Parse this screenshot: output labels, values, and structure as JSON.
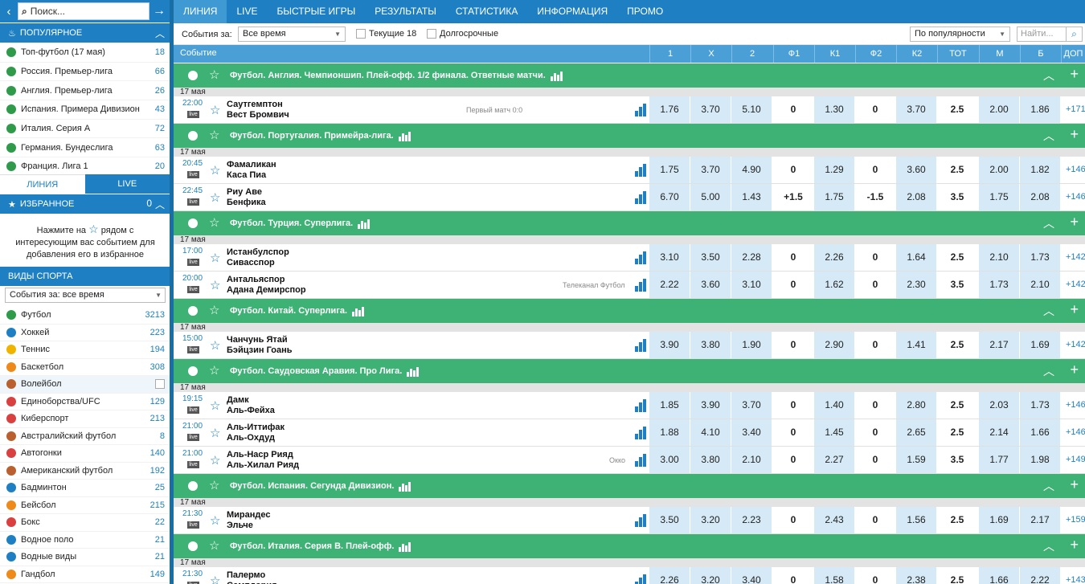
{
  "sidebar": {
    "search_placeholder": "Поиск...",
    "popular_title": "ПОПУЛЯРНОЕ",
    "popular": [
      {
        "label": "Топ-футбол (17 мая)",
        "count": "18"
      },
      {
        "label": "Россия. Премьер-лига",
        "count": "66"
      },
      {
        "label": "Англия. Премьер-лига",
        "count": "26"
      },
      {
        "label": "Испания. Примера Дивизион",
        "count": "43"
      },
      {
        "label": "Италия. Серия А",
        "count": "72"
      },
      {
        "label": "Германия. Бундеслига",
        "count": "63"
      },
      {
        "label": "Франция. Лига 1",
        "count": "20"
      }
    ],
    "tabs": {
      "line": "ЛИНИЯ",
      "live": "LIVE"
    },
    "favorites_title": "ИЗБРАННОЕ",
    "favorites_count": "0",
    "favorites_msg_1": "Нажмите на",
    "favorites_msg_2": "рядом с интересующим вас событием для добавления его в избранное",
    "sports_title": "ВИДЫ СПОРТА",
    "sports_filter": "События за: все время",
    "sports": [
      {
        "label": "Футбол",
        "count": "3213"
      },
      {
        "label": "Хоккей",
        "count": "223"
      },
      {
        "label": "Теннис",
        "count": "194"
      },
      {
        "label": "Баскетбол",
        "count": "308"
      },
      {
        "label": "Волейбол",
        "count": ""
      },
      {
        "label": "Единоборства/UFC",
        "count": "129"
      },
      {
        "label": "Киберспорт",
        "count": "213"
      },
      {
        "label": "Австралийский футбол",
        "count": "8"
      },
      {
        "label": "Автогонки",
        "count": "140"
      },
      {
        "label": "Американский футбол",
        "count": "192"
      },
      {
        "label": "Бадминтон",
        "count": "25"
      },
      {
        "label": "Бейсбол",
        "count": "215"
      },
      {
        "label": "Бокс",
        "count": "22"
      },
      {
        "label": "Водное поло",
        "count": "21"
      },
      {
        "label": "Водные виды",
        "count": "21"
      },
      {
        "label": "Гандбол",
        "count": "149"
      }
    ]
  },
  "nav": [
    "ЛИНИЯ",
    "LIVE",
    "БЫСТРЫЕ ИГРЫ",
    "РЕЗУЛЬТАТЫ",
    "СТАТИСТИКА",
    "ИНФОРМАЦИЯ",
    "ПРОМО"
  ],
  "filters": {
    "period_label": "События за:",
    "period_value": "Все время",
    "current_label": "Текущие 18",
    "longterm_label": "Долгосрочные",
    "sort_value": "По популярности",
    "search_placeholder": "Найти..."
  },
  "table": {
    "event_label": "Событие",
    "columns": [
      "1",
      "X",
      "2",
      "Ф1",
      "К1",
      "Ф2",
      "К2",
      "ТОТ",
      "М",
      "Б",
      "ДОП"
    ]
  },
  "groups": [
    {
      "league": "Футбол. Англия. Чемпионшип. Плей-офф. 1/2 финала. Ответные матчи.",
      "date": "17 мая",
      "events": [
        {
          "time": "22:00",
          "team1": "Саутгемптон",
          "team2": "Вест Бромвич",
          "note": "Первый матч 0:0",
          "odds": [
            "1.76",
            "3.70",
            "5.10",
            "0",
            "1.30",
            "0",
            "3.70",
            "2.5",
            "2.00",
            "1.86",
            "+171"
          ]
        }
      ]
    },
    {
      "league": "Футбол. Португалия. Примейра-лига.",
      "date": "17 мая",
      "events": [
        {
          "time": "20:45",
          "team1": "Фамаликан",
          "team2": "Каса Пиа",
          "note": "",
          "odds": [
            "1.75",
            "3.70",
            "4.90",
            "0",
            "1.29",
            "0",
            "3.60",
            "2.5",
            "2.00",
            "1.82",
            "+146"
          ]
        },
        {
          "time": "22:45",
          "team1": "Риу Аве",
          "team2": "Бенфика",
          "note": "",
          "odds": [
            "6.70",
            "5.00",
            "1.43",
            "+1.5",
            "1.75",
            "-1.5",
            "2.08",
            "3.5",
            "1.75",
            "2.08",
            "+146"
          ]
        }
      ]
    },
    {
      "league": "Футбол. Турция. Суперлига.",
      "date": "17 мая",
      "events": [
        {
          "time": "17:00",
          "team1": "Истанбулспор",
          "team2": "Сивасспор",
          "note": "",
          "odds": [
            "3.10",
            "3.50",
            "2.28",
            "0",
            "2.26",
            "0",
            "1.64",
            "2.5",
            "2.10",
            "1.73",
            "+142"
          ]
        },
        {
          "time": "20:00",
          "team1": "Антальяспор",
          "team2": "Адана Демирспор",
          "note": "Телеканал Футбол",
          "odds": [
            "2.22",
            "3.60",
            "3.10",
            "0",
            "1.62",
            "0",
            "2.30",
            "3.5",
            "1.73",
            "2.10",
            "+142"
          ]
        }
      ]
    },
    {
      "league": "Футбол. Китай. Суперлига.",
      "date": "17 мая",
      "events": [
        {
          "time": "15:00",
          "team1": "Чанчунь Ятай",
          "team2": "Бэйцзин Гоань",
          "note": "",
          "odds": [
            "3.90",
            "3.80",
            "1.90",
            "0",
            "2.90",
            "0",
            "1.41",
            "2.5",
            "2.17",
            "1.69",
            "+142"
          ]
        }
      ]
    },
    {
      "league": "Футбол. Саудовская Аравия. Про Лига.",
      "date": "17 мая",
      "events": [
        {
          "time": "19:15",
          "team1": "Дамк",
          "team2": "Аль-Фейха",
          "note": "",
          "odds": [
            "1.85",
            "3.90",
            "3.70",
            "0",
            "1.40",
            "0",
            "2.80",
            "2.5",
            "2.03",
            "1.73",
            "+146"
          ]
        },
        {
          "time": "21:00",
          "team1": "Аль-Иттифак",
          "team2": "Аль-Охдуд",
          "note": "",
          "odds": [
            "1.88",
            "4.10",
            "3.40",
            "0",
            "1.45",
            "0",
            "2.65",
            "2.5",
            "2.14",
            "1.66",
            "+146"
          ]
        },
        {
          "time": "21:00",
          "team1": "Аль-Наср Рияд",
          "team2": "Аль-Хилал Рияд",
          "note": "Окко",
          "odds": [
            "3.00",
            "3.80",
            "2.10",
            "0",
            "2.27",
            "0",
            "1.59",
            "3.5",
            "1.77",
            "1.98",
            "+149"
          ]
        }
      ]
    },
    {
      "league": "Футбол. Испания. Сегунда Дивизион.",
      "date": "17 мая",
      "events": [
        {
          "time": "21:30",
          "team1": "Мирандес",
          "team2": "Эльче",
          "note": "",
          "odds": [
            "3.50",
            "3.20",
            "2.23",
            "0",
            "2.43",
            "0",
            "1.56",
            "2.5",
            "1.69",
            "2.17",
            "+159"
          ]
        }
      ]
    },
    {
      "league": "Футбол. Италия. Серия B. Плей-офф.",
      "date": "17 мая",
      "events": [
        {
          "time": "21:30",
          "team1": "Палермо",
          "team2": "Сампдория",
          "note": "",
          "odds": [
            "2.26",
            "3.20",
            "3.40",
            "0",
            "1.58",
            "0",
            "2.38",
            "2.5",
            "1.66",
            "2.22",
            "+143"
          ]
        }
      ]
    }
  ],
  "live_badge": "live",
  "colors": {
    "brand": "#1e80c2",
    "league_bar": "#3eb174",
    "odd_cell": "#d6e9f6"
  }
}
